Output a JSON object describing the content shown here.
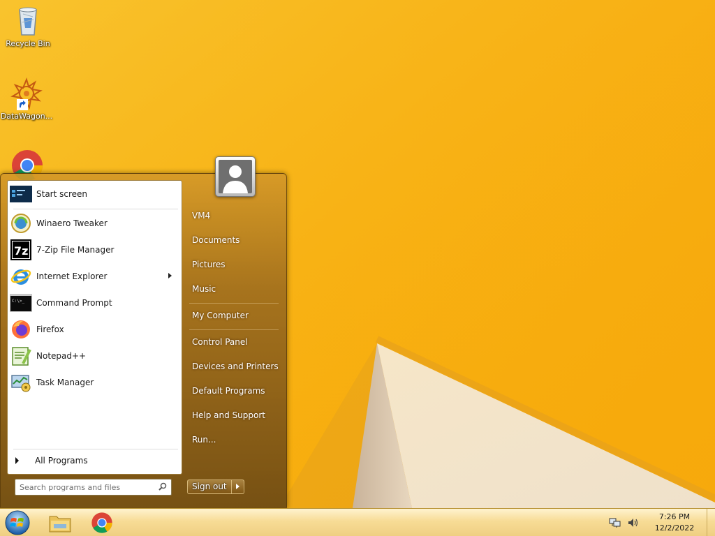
{
  "desktop": {
    "icons": [
      {
        "label": "Recycle Bin",
        "icon": "recycle-bin-icon"
      },
      {
        "label": "DataWagon...",
        "icon": "datawagon-icon"
      },
      {
        "label": "",
        "icon": "chrome-icon"
      }
    ]
  },
  "start_menu": {
    "programs": [
      {
        "label": "Start screen",
        "icon": "start-screen-icon"
      },
      {
        "label": "Winaero Tweaker",
        "icon": "winaero-tweaker-icon"
      },
      {
        "label": "7-Zip File Manager",
        "icon": "seven-zip-icon"
      },
      {
        "label": "Internet Explorer",
        "icon": "internet-explorer-icon",
        "has_submenu": true
      },
      {
        "label": "Command Prompt",
        "icon": "command-prompt-icon"
      },
      {
        "label": "Firefox",
        "icon": "firefox-icon"
      },
      {
        "label": "Notepad++",
        "icon": "notepadpp-icon"
      },
      {
        "label": "Task Manager",
        "icon": "task-manager-icon"
      }
    ],
    "all_programs_label": "All Programs",
    "search_placeholder": "Search programs and files",
    "right_items": [
      {
        "label": "VM4"
      },
      {
        "label": "Documents"
      },
      {
        "label": "Pictures"
      },
      {
        "label": "Music"
      },
      {
        "label": "My Computer"
      },
      {
        "label": "Control Panel"
      },
      {
        "label": "Devices and Printers"
      },
      {
        "label": "Default Programs"
      },
      {
        "label": "Help and Support"
      },
      {
        "label": "Run..."
      }
    ],
    "sign_out_label": "Sign out"
  },
  "taskbar": {
    "pinned": [
      {
        "icon": "file-explorer-icon"
      },
      {
        "icon": "chrome-icon"
      }
    ],
    "tray": [
      {
        "icon": "network-icon"
      },
      {
        "icon": "volume-icon"
      }
    ],
    "clock": {
      "time": "7:26 PM",
      "date": "12/2/2022"
    }
  },
  "colors": {
    "wallpaper": "#f7b40b",
    "start_menu_glass": "#a06e1e",
    "taskbar": "#f7dc96"
  }
}
